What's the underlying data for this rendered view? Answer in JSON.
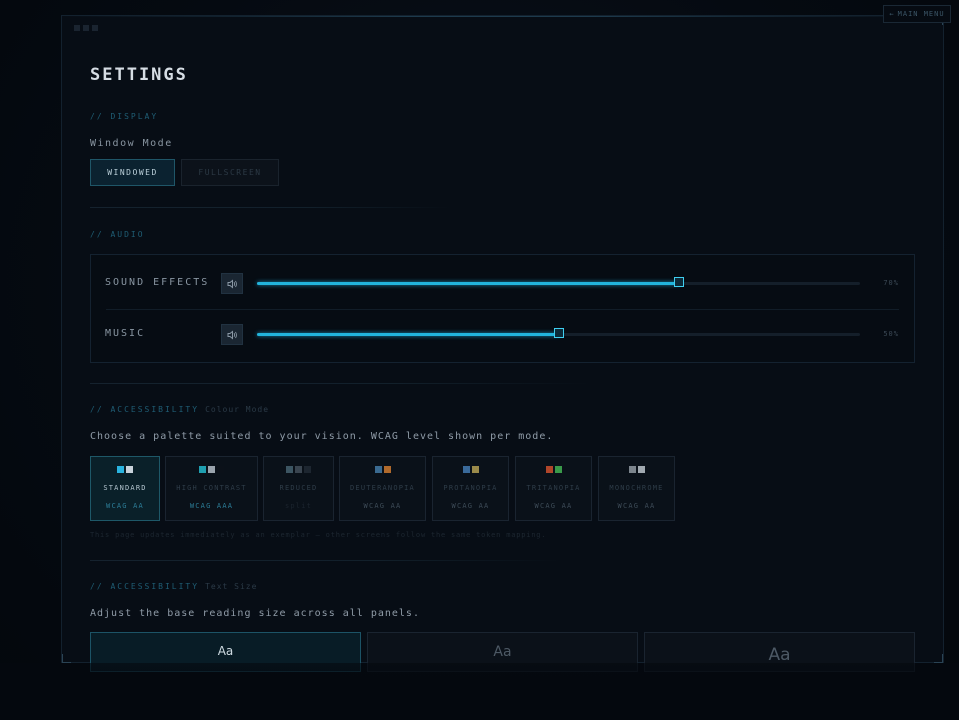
{
  "nav": {
    "back_arrow": "←",
    "main_menu_label": "MAIN MENU"
  },
  "page": {
    "title": "SETTINGS"
  },
  "display": {
    "section_label": "// DISPLAY",
    "window_mode_label": "Window Mode",
    "options": [
      {
        "label": "WINDOWED",
        "selected": true
      },
      {
        "label": "FULLSCREEN",
        "selected": false
      }
    ]
  },
  "audio": {
    "section_label": "// AUDIO",
    "channels": [
      {
        "label": "SOUND EFFECTS",
        "value": 70,
        "value_label": "70%"
      },
      {
        "label": "MUSIC",
        "value": 50,
        "value_label": "50%"
      }
    ]
  },
  "colour_mode": {
    "section_label": "// ACCESSIBILITY",
    "section_sub": "Colour Mode",
    "description": "Choose a palette suited to your vision. WCAG level shown per mode.",
    "palettes": [
      {
        "name": "STANDARD",
        "level": "WCAG AA",
        "selected": true,
        "swatches": [
          "#2ab4e0",
          "#c9d3dc"
        ]
      },
      {
        "name": "HIGH CONTRAST",
        "level": "WCAG AAA",
        "selected": false,
        "swatches": [
          "#1f9fb0",
          "#9aa4ad",
          "#0b1119"
        ]
      },
      {
        "name": "REDUCED",
        "level": "split",
        "selected": false,
        "swatches": [
          "#3c5562",
          "#3a4550",
          "#1d2630"
        ]
      },
      {
        "name": "DEUTERANOPIA",
        "level": "WCAG AA",
        "selected": false,
        "swatches": [
          "#3a6a90",
          "#b06a2c"
        ]
      },
      {
        "name": "PROTANOPIA",
        "level": "WCAG AA",
        "selected": false,
        "swatches": [
          "#3a6a9a",
          "#9a8a4a"
        ]
      },
      {
        "name": "TRITANOPIA",
        "level": "WCAG AA",
        "selected": false,
        "swatches": [
          "#b0462a",
          "#3a9a4a"
        ]
      },
      {
        "name": "MONOCHROME",
        "level": "WCAG AA",
        "selected": false,
        "swatches": [
          "#7c858d",
          "#a1a9b0"
        ]
      }
    ],
    "footnote": "This page updates immediately as an exemplar — other screens follow the same token mapping."
  },
  "text_size": {
    "section_label": "// ACCESSIBILITY",
    "section_sub": "Text Size",
    "description": "Adjust the base reading size across all panels.",
    "options": [
      {
        "label": "Aa",
        "selected": true
      },
      {
        "label": "Aa",
        "selected": false
      },
      {
        "label": "Aa",
        "selected": false
      }
    ]
  },
  "colors": {
    "accent": "#22b4dc",
    "background": "#070d15"
  }
}
